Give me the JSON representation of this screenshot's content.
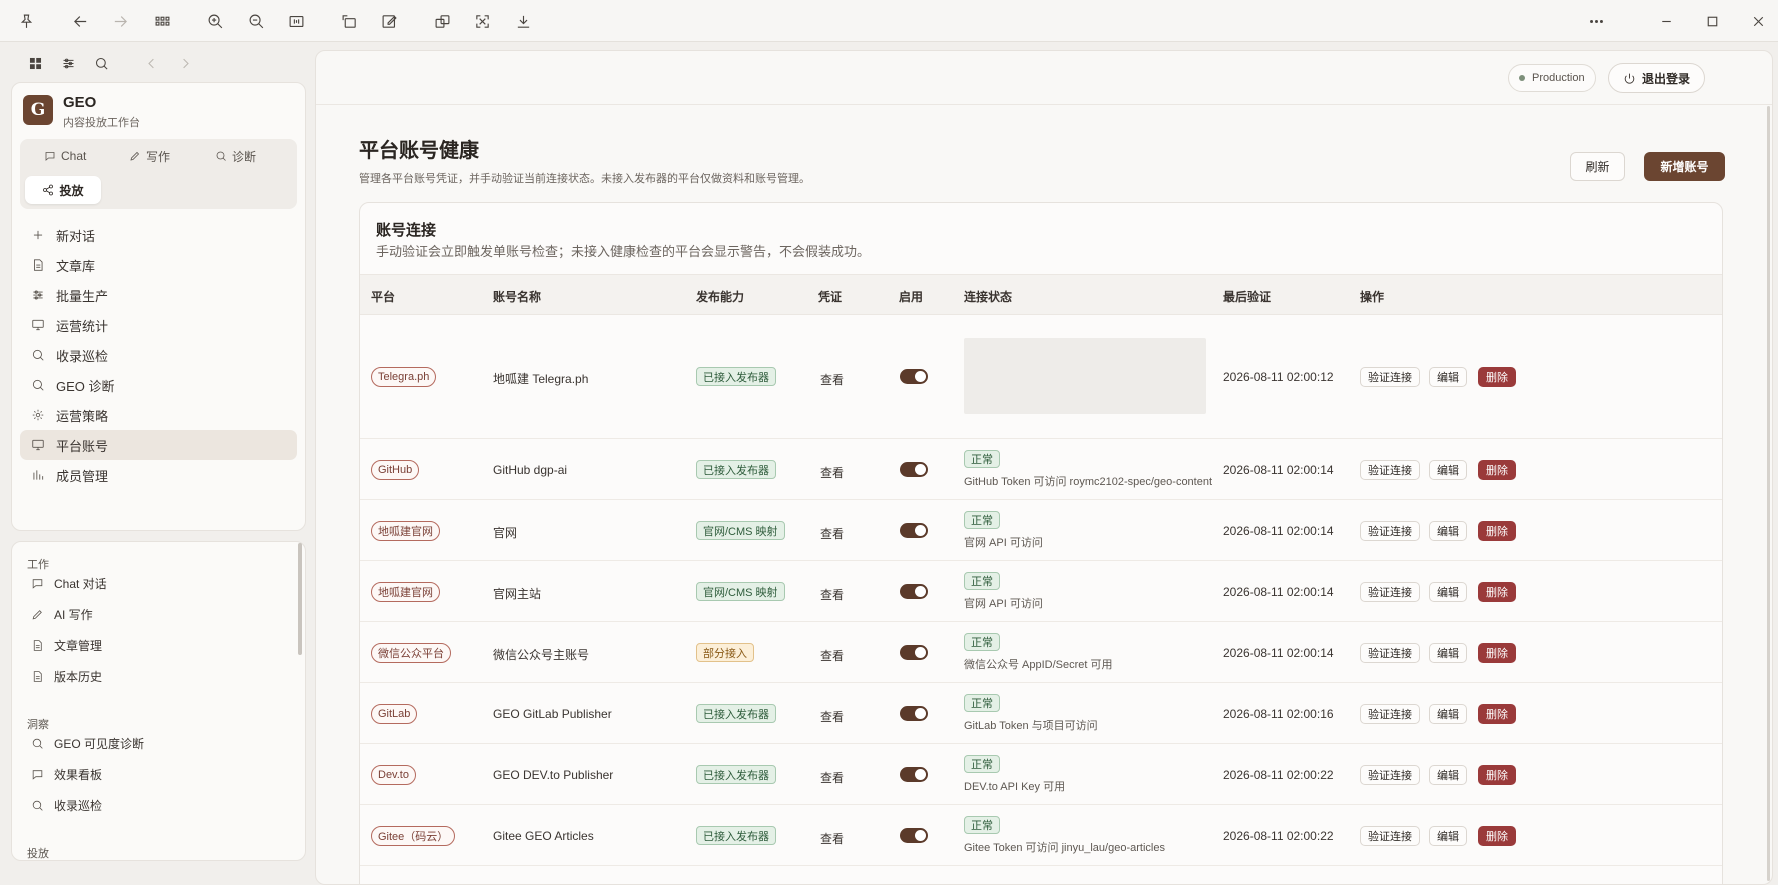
{
  "sidebar": {
    "brand_initial": "G",
    "brand_name": "GEO",
    "brand_sub": "内容投放工作台",
    "modes": [
      {
        "label": "Chat",
        "icon": "chat-icon"
      },
      {
        "label": "写作",
        "icon": "pen-icon"
      },
      {
        "label": "诊断",
        "icon": "search-icon"
      },
      {
        "label": "投放",
        "icon": "share-icon",
        "active": true
      }
    ],
    "nav_items": [
      {
        "label": "新对话",
        "icon": "plus-icon"
      },
      {
        "label": "文章库",
        "icon": "document-icon"
      },
      {
        "label": "批量生产",
        "icon": "sliders-icon"
      },
      {
        "label": "运营统计",
        "icon": "monitor-icon"
      },
      {
        "label": "收录巡检",
        "icon": "search-icon"
      },
      {
        "label": "GEO 诊断",
        "icon": "search-icon"
      },
      {
        "label": "运营策略",
        "icon": "gear-icon"
      },
      {
        "label": "平台账号",
        "icon": "monitor-icon",
        "active": true
      },
      {
        "label": "成员管理",
        "icon": "bar-chart-icon"
      }
    ],
    "section_work": "工作",
    "work_items": [
      {
        "label": "Chat 对话",
        "icon": "chat-icon"
      },
      {
        "label": "AI 写作",
        "icon": "pen-icon"
      },
      {
        "label": "文章管理",
        "icon": "document-icon"
      },
      {
        "label": "版本历史",
        "icon": "document-icon"
      }
    ],
    "section_insight": "洞察",
    "insight_items": [
      {
        "label": "GEO 可见度诊断",
        "icon": "search-icon"
      },
      {
        "label": "效果看板",
        "icon": "chat-icon"
      },
      {
        "label": "收录巡检",
        "icon": "search-icon"
      }
    ],
    "section_publish": "投放"
  },
  "header": {
    "env_label": "Production",
    "logout_label": "退出登录"
  },
  "page": {
    "title": "平台账号健康",
    "description": "管理各平台账号凭证，并手动验证当前连接状态。未接入发布器的平台仅做资料和账号管理。",
    "refresh_label": "刷新",
    "add_label": "新增账号"
  },
  "card": {
    "title": "账号连接",
    "description": "手动验证会立即触发单账号检查；未接入健康检查的平台会显示警告，不会假装成功。"
  },
  "table": {
    "columns": [
      "平台",
      "账号名称",
      "发布能力",
      "凭证",
      "启用",
      "连接状态",
      "最后验证",
      "操作"
    ],
    "credential_label": "查看",
    "verify_label": "验证连接",
    "edit_label": "编辑",
    "delete_label": "删除",
    "rows": [
      {
        "platform": "Telegra.ph",
        "account": "地呱建 Telegra.ph",
        "capability": "已接入发布器",
        "cap_type": "ok",
        "enabled": true,
        "status": "",
        "status_note": "",
        "last_verified": "2026-08-11 02:00:12"
      },
      {
        "platform": "GitHub",
        "account": "GitHub dgp-ai",
        "capability": "已接入发布器",
        "cap_type": "ok",
        "enabled": true,
        "status": "正常",
        "status_note": "GitHub Token 可访问 roymc2102-spec/geo-content",
        "last_verified": "2026-08-11 02:00:14"
      },
      {
        "platform": "地呱建官网",
        "account": "官网",
        "capability": "官网/CMS 映射",
        "cap_type": "ok",
        "enabled": true,
        "status": "正常",
        "status_note": "官网 API 可访问",
        "last_verified": "2026-08-11 02:00:14"
      },
      {
        "platform": "地呱建官网",
        "account": "官网主站",
        "capability": "官网/CMS 映射",
        "cap_type": "ok",
        "enabled": true,
        "status": "正常",
        "status_note": "官网 API 可访问",
        "last_verified": "2026-08-11 02:00:14"
      },
      {
        "platform": "微信公众平台",
        "account": "微信公众号主账号",
        "capability": "部分接入",
        "cap_type": "warn",
        "enabled": true,
        "status": "正常",
        "status_note": "微信公众号 AppID/Secret 可用",
        "last_verified": "2026-08-11 02:00:14"
      },
      {
        "platform": "GitLab",
        "account": "GEO GitLab Publisher",
        "capability": "已接入发布器",
        "cap_type": "ok",
        "enabled": true,
        "status": "正常",
        "status_note": "GitLab Token 与项目可访问",
        "last_verified": "2026-08-11 02:00:16"
      },
      {
        "platform": "Dev.to",
        "account": "GEO DEV.to Publisher",
        "capability": "已接入发布器",
        "cap_type": "ok",
        "enabled": true,
        "status": "正常",
        "status_note": "DEV.to API Key 可用",
        "last_verified": "2026-08-11 02:00:22"
      },
      {
        "platform": "Gitee（码云）",
        "account": "Gitee GEO Articles",
        "capability": "已接入发布器",
        "cap_type": "ok",
        "enabled": true,
        "status": "正常",
        "status_note": "Gitee Token 可访问 jinyu_lau/geo-articles",
        "last_verified": "2026-08-11 02:00:22"
      }
    ]
  },
  "colors": {
    "accent": "#6b4531",
    "danger": "#9a3a3a",
    "success_bg": "#e4f0e6",
    "warn_bg": "#fcefd8"
  }
}
